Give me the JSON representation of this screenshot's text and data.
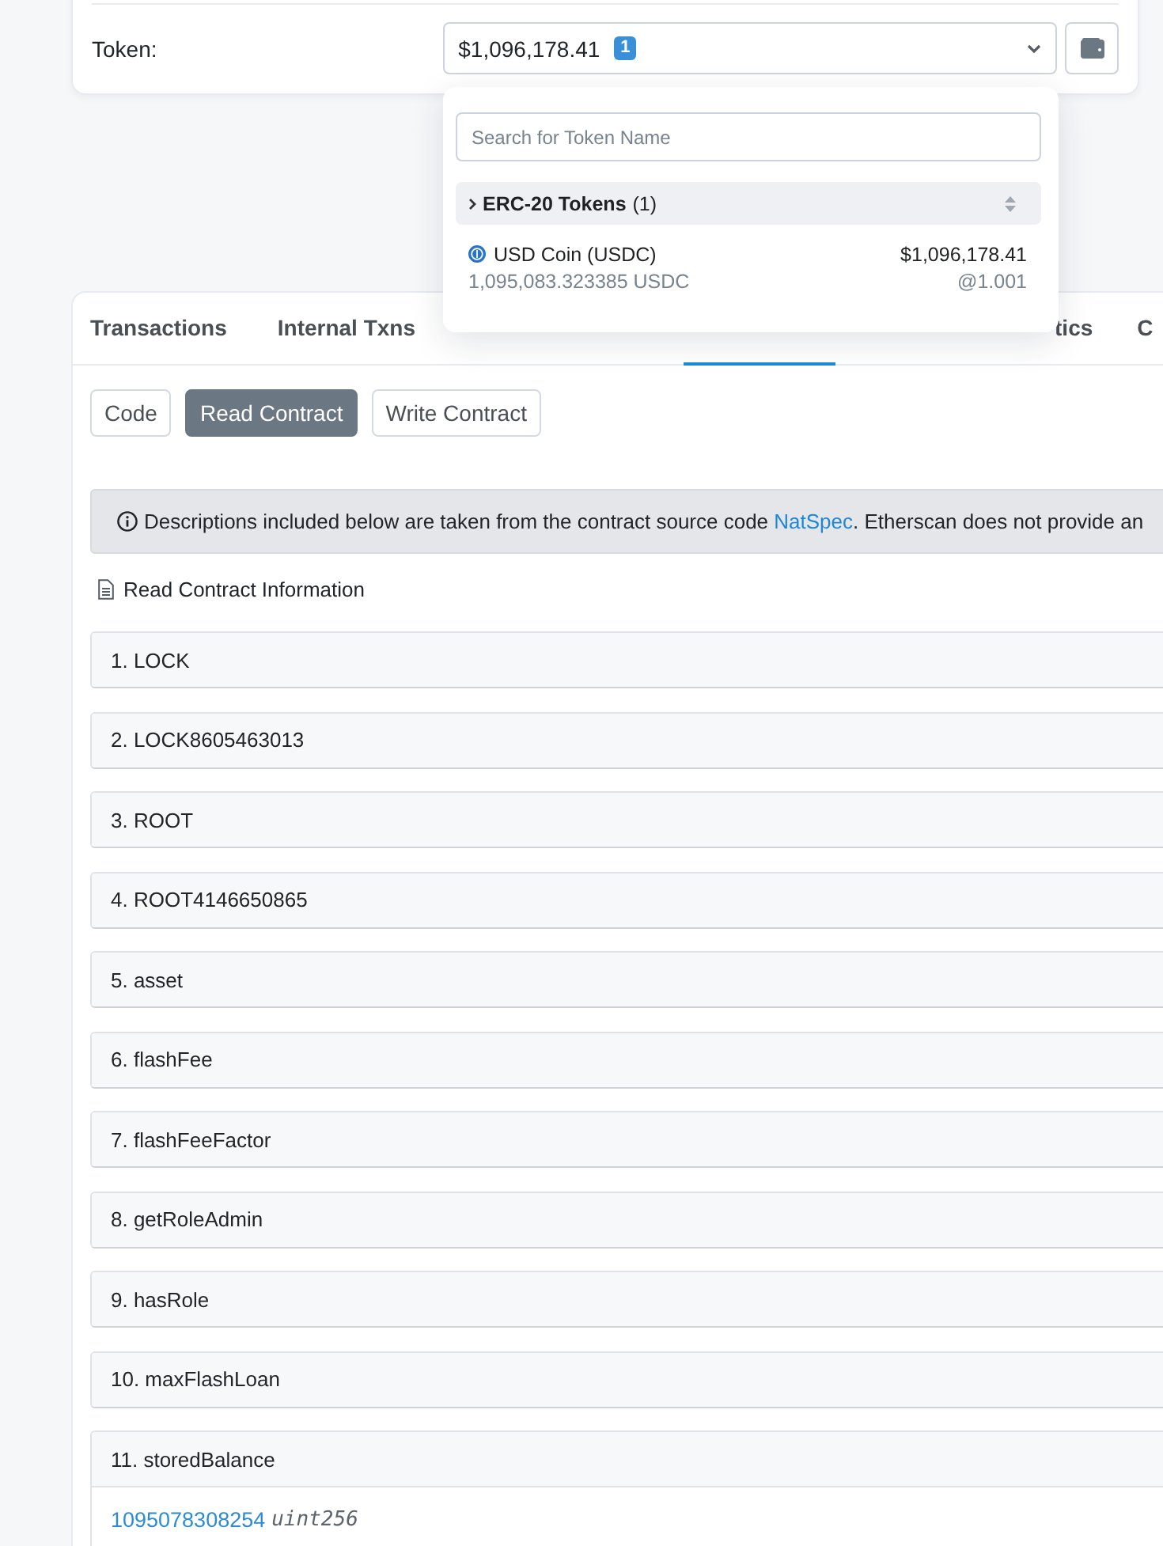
{
  "token_card": {
    "label": "Token:",
    "value": "$1,096,178.41",
    "count_badge": "1"
  },
  "token_dropdown": {
    "search": {
      "placeholder": "Search for Token Name"
    },
    "groups": [
      {
        "name": "ERC-20 Tokens",
        "count": "(1)",
        "tokens": [
          {
            "name": "USD Coin (USDC)",
            "value": "$1,096,178.41",
            "amount": "1,095,083.323385 USDC",
            "rate": "@1.001"
          }
        ]
      }
    ]
  },
  "tabs": [
    {
      "kind": "tab",
      "label": "Transactions",
      "selected": false
    },
    {
      "kind": "tab",
      "label": "Internal Txns",
      "selected": false
    },
    {
      "kind": "covered",
      "selected": false
    },
    {
      "kind": "covered",
      "selected": true
    },
    {
      "kind": "covered",
      "selected": false
    },
    {
      "kind": "partly_covered",
      "label": "tics",
      "selected": false
    },
    {
      "kind": "tab",
      "label": "C",
      "selected": false
    }
  ],
  "contract_buttons": [
    {
      "label": "Code",
      "selected": false
    },
    {
      "label": "Read Contract",
      "selected": true
    },
    {
      "label": "Write Contract",
      "selected": false
    }
  ],
  "notice": {
    "text_before": "Descriptions included below are taken from the contract source code ",
    "link": "NatSpec",
    "text_after": ". Etherscan does not provide an"
  },
  "section_title": "Read Contract Information",
  "functions": [
    {
      "label": "1. LOCK",
      "expanded": false
    },
    {
      "label": "2. LOCK8605463013",
      "expanded": false
    },
    {
      "label": "3. ROOT",
      "expanded": false
    },
    {
      "label": "4. ROOT4146650865",
      "expanded": false
    },
    {
      "label": "5. asset",
      "expanded": false
    },
    {
      "label": "6. flashFee",
      "expanded": false
    },
    {
      "label": "7. flashFeeFactor",
      "expanded": false
    },
    {
      "label": "8. getRoleAdmin",
      "expanded": false
    },
    {
      "label": "9. hasRole",
      "expanded": false
    },
    {
      "label": "10. maxFlashLoan",
      "expanded": false
    },
    {
      "label": "11. storedBalance",
      "expanded": true,
      "result": {
        "value": "1095078308254",
        "type": "uint256"
      }
    }
  ]
}
